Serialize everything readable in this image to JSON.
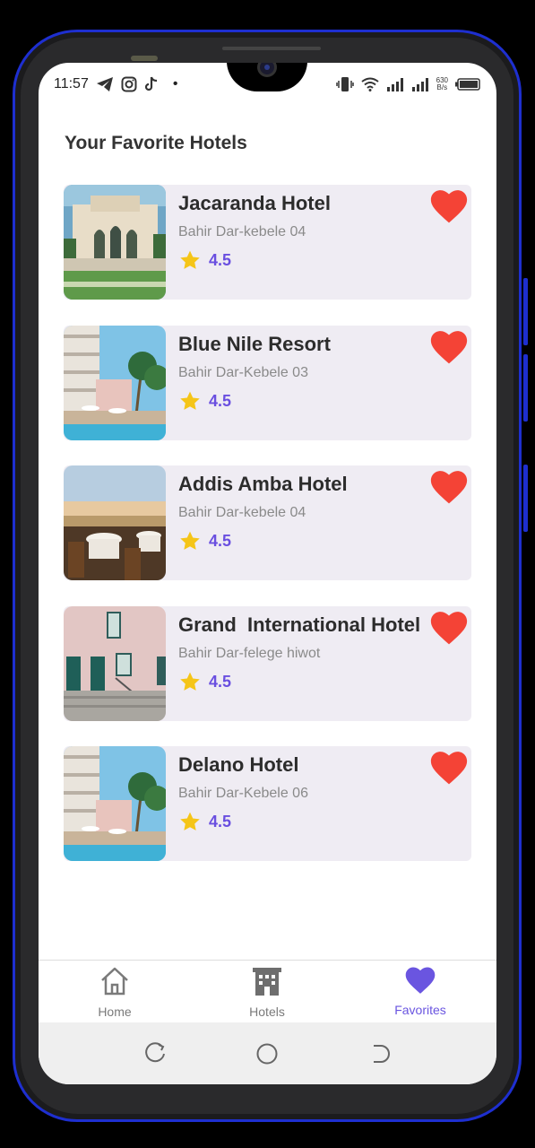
{
  "status_bar": {
    "time": "11:57",
    "dot": "•",
    "net_speed_value": "630",
    "net_speed_unit": "B/s"
  },
  "page": {
    "title": "Your Favorite Hotels"
  },
  "hotels": [
    {
      "name": "Jacaranda Hotel",
      "location": "Bahir Dar-kebele 04",
      "rating": "4.5",
      "favorite": true
    },
    {
      "name": "Blue Nile Resort",
      "location": "Bahir Dar-Kebele 03",
      "rating": "4.5",
      "favorite": true
    },
    {
      "name": "Addis Amba Hotel",
      "location": "Bahir Dar-kebele 04",
      "rating": "4.5",
      "favorite": true
    },
    {
      "name": "Grand  International Hotel",
      "location": "Bahir Dar-felege hiwot",
      "rating": "4.5",
      "favorite": true
    },
    {
      "name": "Delano Hotel",
      "location": "Bahir Dar-Kebele 06",
      "rating": "4.5",
      "favorite": true
    }
  ],
  "bottom_nav": {
    "items": [
      {
        "label": "Home",
        "icon": "home-icon",
        "active": false
      },
      {
        "label": "Hotels",
        "icon": "building-icon",
        "active": false
      },
      {
        "label": "Favorites",
        "icon": "heart-icon",
        "active": true
      }
    ]
  },
  "colors": {
    "accent": "#6a55e0",
    "heart": "#f44336",
    "star": "#f5c518",
    "card_bg": "#efecf3",
    "phone_frame": "#1e2fd0"
  }
}
